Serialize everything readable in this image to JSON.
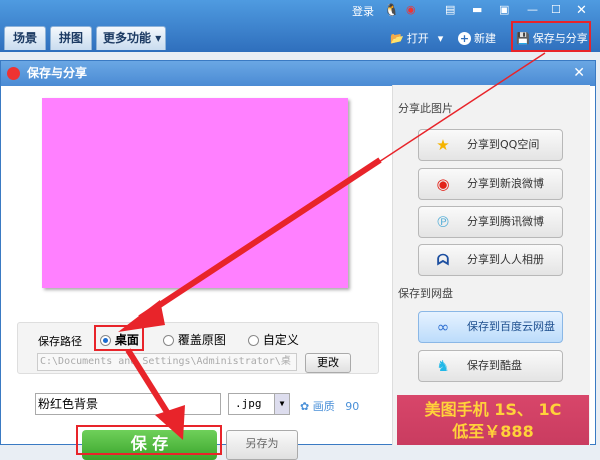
{
  "top": {
    "login": "登录",
    "tabs": [
      "场景",
      "拼图",
      "更多功能"
    ],
    "open": "打开",
    "new": "新建",
    "save_share": "保存与分享"
  },
  "dialog": {
    "title": "保存与分享",
    "save_path_label": "保存路径",
    "radios": [
      {
        "label": "桌面",
        "checked": true
      },
      {
        "label": "覆盖原图",
        "checked": false
      },
      {
        "label": "自定义",
        "checked": false
      }
    ],
    "path_value": "C:\\Documents and Settings\\Administrator\\桌",
    "change": "更改",
    "filename": "粉红色背景",
    "format": ".jpg",
    "quality_label": "画质",
    "quality": "90",
    "save": "保 存",
    "save_as": "另存为",
    "share_title": "分享此图片",
    "share": [
      {
        "label": "分享到QQ空间",
        "icon": "qzone-star-icon"
      },
      {
        "label": "分享到新浪微博",
        "icon": "weibo-icon"
      },
      {
        "label": "分享到腾讯微博",
        "icon": "tencent-weibo-icon"
      },
      {
        "label": "分享到人人相册",
        "icon": "renren-icon"
      }
    ],
    "cloud_title": "保存到网盘",
    "cloud": [
      {
        "label": "保存到百度云网盘",
        "icon": "baidu-cloud-icon"
      },
      {
        "label": "保存到酷盘",
        "icon": "kupan-icon"
      }
    ],
    "ad": [
      "美图手机 1S、 1C",
      "低至￥888"
    ]
  },
  "colors": {
    "canvas": "#ff80ff",
    "highlight": "#e8242a"
  }
}
